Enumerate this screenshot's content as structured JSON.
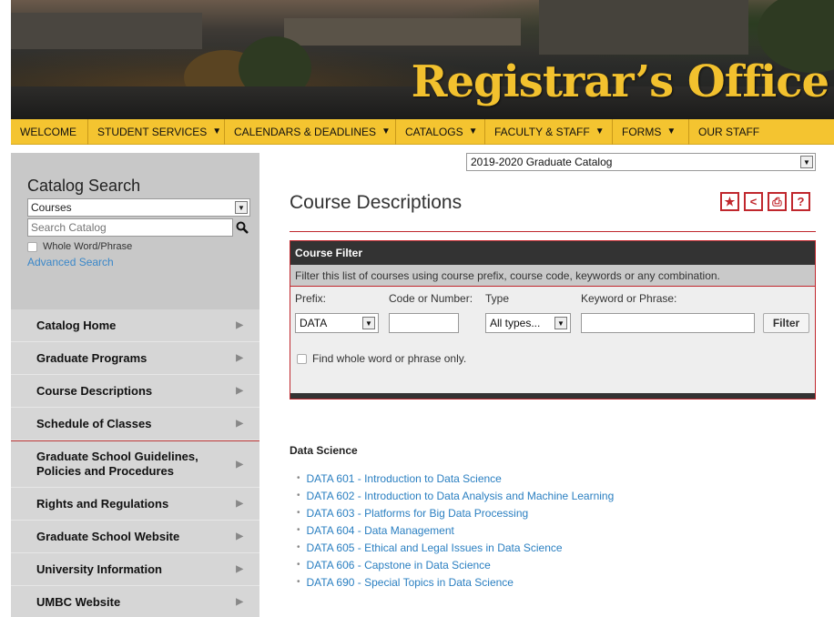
{
  "banner": {
    "title": "Registrar’s Office"
  },
  "nav": {
    "items": [
      {
        "label": "WELCOME",
        "arrow": ""
      },
      {
        "label": "STUDENT SERVICES",
        "arrow": "▼"
      },
      {
        "label": "CALENDARS & DEADLINES",
        "arrow": "▼"
      },
      {
        "label": "CATALOGS",
        "arrow": "▼"
      },
      {
        "label": "FACULTY & STAFF",
        "arrow": "▼"
      },
      {
        "label": "FORMS",
        "arrow": "▼"
      },
      {
        "label": "OUR STAFF",
        "arrow": ""
      }
    ]
  },
  "sidebar": {
    "search_title": "Catalog Search",
    "scope_value": "Courses",
    "search_placeholder": "Search Catalog",
    "whole_word_label": "Whole Word/Phrase",
    "advanced_label": "Advanced Search",
    "items": [
      "Catalog Home",
      "Graduate Programs",
      "Course Descriptions",
      "Schedule of Classes",
      "Graduate School Guidelines, Policies and Procedures",
      "Rights and Regulations",
      "Graduate School Website",
      "University Information",
      "UMBC Website"
    ]
  },
  "main": {
    "catalog_select": "2019-2020 Graduate Catalog",
    "page_title": "Course Descriptions",
    "tools": [
      "★",
      "<",
      "⎙",
      "?"
    ],
    "filter": {
      "header": "Course Filter",
      "description": "Filter this list of courses using course prefix, course code, keywords or any combination.",
      "labels": {
        "prefix": "Prefix:",
        "code": "Code or Number:",
        "type": "Type",
        "keyword": "Keyword or Phrase:"
      },
      "prefix_value": "DATA",
      "code_value": "",
      "type_value": "All types...",
      "keyword_value": "",
      "button_label": "Filter",
      "find_whole_label": "Find whole word or phrase only."
    },
    "section_title": "Data Science",
    "courses": [
      "DATA 601 - Introduction to Data Science",
      "DATA 602 - Introduction to Data Analysis and Machine Learning",
      "DATA 603 - Platforms for Big Data Processing",
      "DATA 604 - Data Management",
      "DATA 605 - Ethical and Legal Issues in Data Science",
      "DATA 606 - Capstone in Data Science",
      "DATA 690 - Special Topics in Data Science"
    ]
  }
}
